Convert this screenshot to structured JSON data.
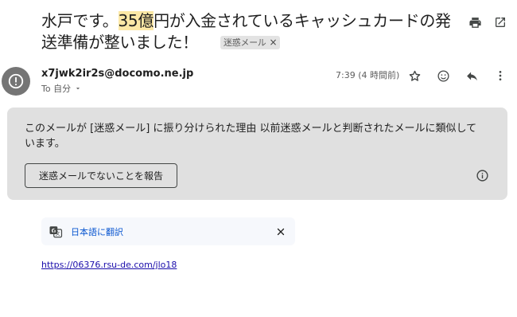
{
  "subject": {
    "part1": "水戸です。",
    "highlight": "35億",
    "part2": "円が入金されているキャッシュカードの発送準備が整いました！",
    "spam_label": "迷惑メール",
    "spam_label_close": "×"
  },
  "toolbar_top": {
    "print_icon": "print-icon",
    "popout_icon": "open-in-new-window-icon"
  },
  "message": {
    "sender_email": "x7jwk2ir2s@docomo.ne.jp",
    "to_text": "To 自分",
    "time": "7:39 (4 時間前)"
  },
  "actions": [
    "star-icon",
    "emoji-react-icon",
    "reply-icon",
    "more-vert-icon"
  ],
  "spam_banner": {
    "text": "このメールが [迷惑メール] に振り分けられた理由 以前迷惑メールと判断されたメールに類似しています。",
    "button_label": "迷惑メールでないことを報告"
  },
  "translate": {
    "link_label": "日本語に翻訳",
    "close": "×"
  },
  "body": {
    "link_text": "https://06376.rsu-de.com/jlo18"
  },
  "colors": {
    "highlight": "#fce8a6",
    "banner_bg": "#e0e0e0",
    "link": "#1a0dab",
    "avatar_bg": "#757575"
  }
}
